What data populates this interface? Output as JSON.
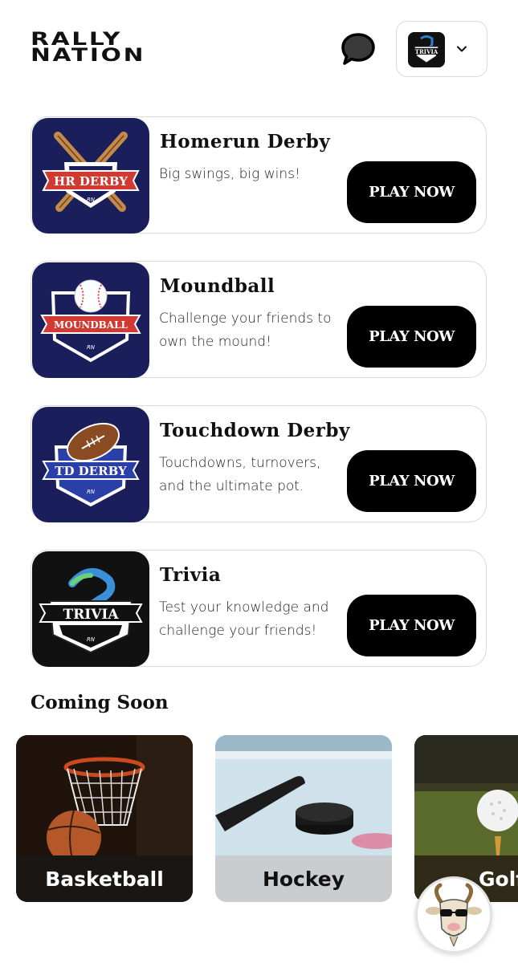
{
  "app": {
    "logo_line1": "RALLY",
    "logo_line2": "NATION"
  },
  "header": {
    "chat_icon": "chat-bubble-icon",
    "game_selector": {
      "thumb_text": "TRIVIA",
      "chevron_icon": "chevron-down-icon"
    }
  },
  "games": [
    {
      "title": "Homerun Derby",
      "description": "Big swings, big wins!",
      "play_label": "PLAY NOW",
      "badge_text": "HR DERBY",
      "badge_sub": "RN"
    },
    {
      "title": "Moundball",
      "description": "Challenge your friends to own the mound!",
      "play_label": "PLAY NOW",
      "badge_text": "MOUNDBALL",
      "badge_sub": "RN"
    },
    {
      "title": "Touchdown Derby",
      "description": "Touchdowns, turnovers, and the ultimate pot.",
      "play_label": "PLAY NOW",
      "badge_text": "TD DERBY",
      "badge_sub": "RN"
    },
    {
      "title": "Trivia",
      "description": "Test your knowledge and challenge your friends!",
      "play_label": "PLAY NOW",
      "badge_text": "TRIVIA",
      "badge_sub": "RN"
    }
  ],
  "coming_soon": {
    "title": "Coming Soon",
    "items": [
      {
        "label": "Basketball"
      },
      {
        "label": "Hockey"
      },
      {
        "label": "Golf"
      }
    ]
  },
  "colors": {
    "navy": "#1a1f5c",
    "badge_red": "#d13a33",
    "black": "#000000",
    "card_border": "#d8d8de"
  }
}
